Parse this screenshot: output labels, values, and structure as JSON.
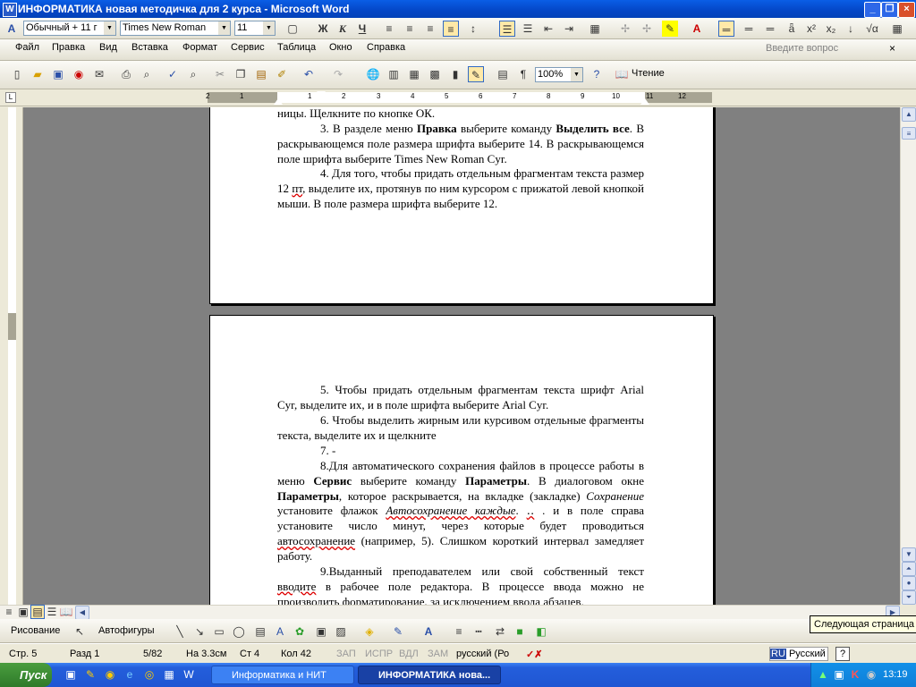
{
  "window": {
    "title": "ИНФОРМАТИКА новая методичка для 2 курса - Microsoft Word",
    "minimize": "_",
    "maximize": "❐",
    "close": "×"
  },
  "format_toolbar": {
    "style": "Обычный + 11 г",
    "font": "Times New Roman",
    "size": "11",
    "bold": "Ж",
    "italic": "К",
    "underline": "Ч"
  },
  "menu": {
    "items": [
      "Файл",
      "Правка",
      "Вид",
      "Вставка",
      "Формат",
      "Сервис",
      "Таблица",
      "Окно",
      "Справка"
    ],
    "help_placeholder": "Введите вопрос",
    "help_close": "×"
  },
  "standard_toolbar": {
    "zoom": "100%",
    "reading": "Чтение"
  },
  "ruler": {
    "numbers": [
      "2",
      "1",
      "1",
      "2",
      "3",
      "4",
      "5",
      "6",
      "7",
      "8",
      "9",
      "10",
      "11",
      "12"
    ]
  },
  "document": {
    "page1": {
      "line0": "ницы. Щелкните по кнопке ОК.",
      "p3": {
        "a": "3. В разделе меню ",
        "b1": "Правка",
        "c": " выберите команду ",
        "b2": "Выделить все",
        "d": ". В раскрывающемся поле размера шрифта выберите 14. В раскрывающемся поле шрифта выберите Times New Roman Cyr."
      },
      "p4": {
        "a": "4. Для того",
        "b": ", чтобы придать отдельным фрагментам текста размер 12 ",
        "c": "пт",
        "d": ", выделите их, протянув по ним курсором с прижатой левой кнопкой мыши. В поле размера шрифта выберите 12."
      }
    },
    "page2": {
      "p5": "5. Чтобы придать отдельным фрагментам текста шрифт Arial Cyr, выделите их, и в поле шрифта выберите Arial Cyr.",
      "p6": "6. Чтобы выделить жирным или курсивом отдельные фрагменты текста, выделите их и щелкните",
      "p7": "7. -",
      "p8": {
        "a": "8.Для автоматического сохранения файлов в процессе работы в меню ",
        "b1": "Сервис",
        "c": " выберите команду ",
        "b2": "Параметры",
        "d": ". В диалоговом окне ",
        "b3": "Параметры",
        "e": ", которое раскрывается, на вкладке (закладке) ",
        "i1": "Сохранение",
        "f": " установите флажок ",
        "i2": "Автосохранение каждые",
        "g": ". ",
        "h": "‥",
        "j": " . и в поле справа установите число минут, через которые будет проводиться ",
        "k": "автосохранение",
        "l": " (например, 5). Слишком короткий интервал замедляет работу."
      },
      "p9": {
        "a": "9.Выданный преподавателем или свой собственный текст ",
        "b": "вводите",
        "c": " в рабочее поле редактора. В процессе ввода можно не производить форматирование, за исключением ввода абзацев."
      }
    }
  },
  "drawing_toolbar": {
    "drawing": "Рисование",
    "autoshapes": "Автофигуры"
  },
  "tooltip": "Следующая страница",
  "status": {
    "page": "Стр. 5",
    "section": "Разд 1",
    "pages": "5/82",
    "at": "На 3.3см",
    "line": "Ст 4",
    "col": "Кол 42",
    "rec": "ЗАП",
    "trk": "ИСПР",
    "ext": "ВДЛ",
    "ovr": "ЗАМ",
    "lang": "русский (Ро",
    "ime": "Русский",
    "ime_code": "RU"
  },
  "taskbar": {
    "start": "Пуск",
    "task1": "Информатика и НИТ",
    "task2": "ИНФОРМАТИКА нова...",
    "clock": "13:19"
  }
}
